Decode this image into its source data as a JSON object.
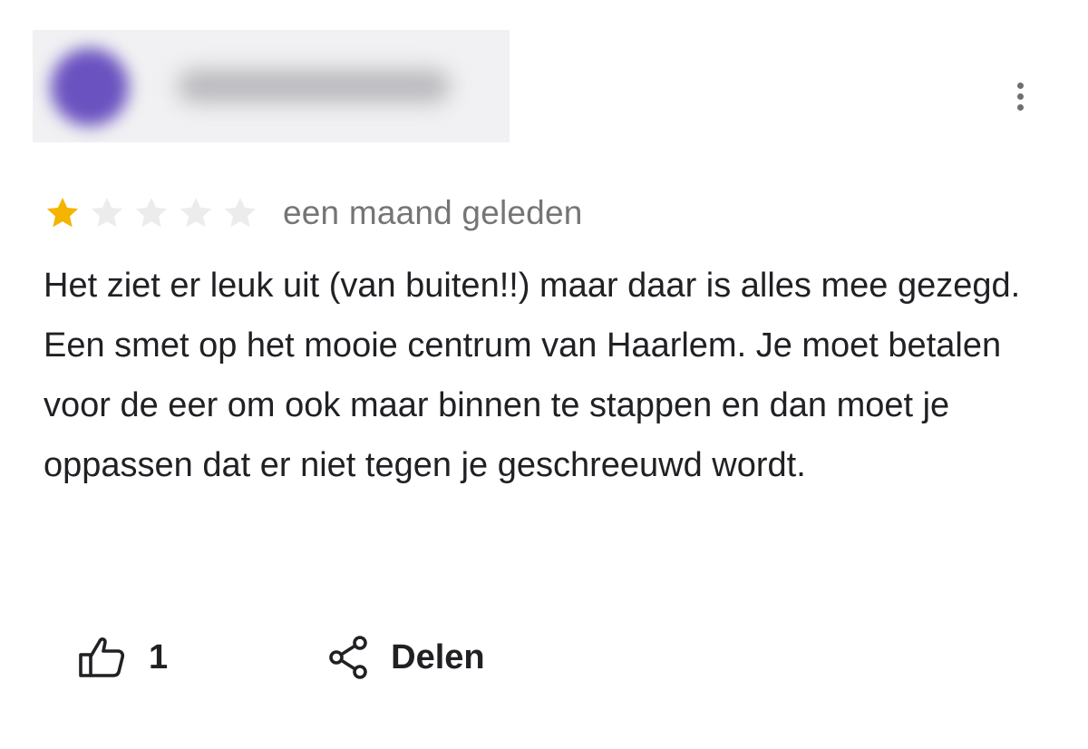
{
  "review": {
    "rating": 1,
    "max_rating": 5,
    "star_filled_color": "#f4b400",
    "star_empty_color": "#ececec",
    "time": "een maand geleden",
    "text": "Het ziet er leuk uit (van buiten!!) maar daar is alles mee gezegd. Een smet op het mooie centrum van Haarlem. Je moet betalen voor de eer om ook maar binnen te stappen en dan moet je oppassen dat er niet tegen je geschreeuwd wordt."
  },
  "actions": {
    "like_icon": "thumb-up-icon",
    "like_count": "1",
    "share_icon": "share-icon",
    "share_label": "Delen"
  },
  "menu": {
    "icon": "more-vert-icon"
  }
}
